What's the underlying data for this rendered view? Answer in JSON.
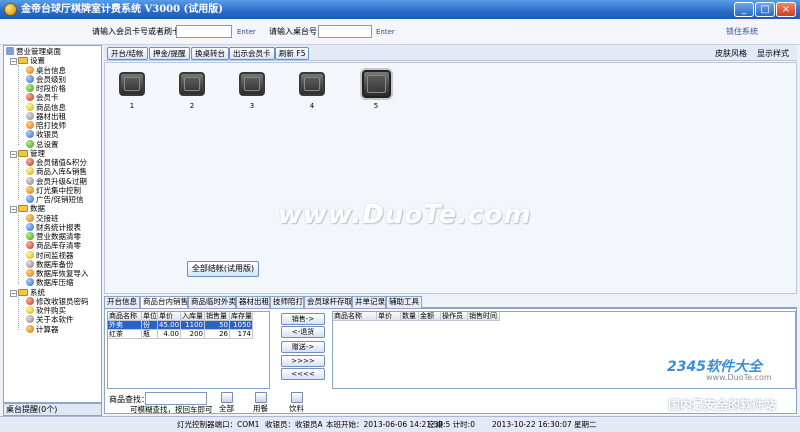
{
  "window": {
    "title": "金帝台球厅棋牌室计费系统 V3000 (试用版)",
    "minimize": "_",
    "maximize": "□",
    "close": "×"
  },
  "topbar": {
    "member_card_label": "请输入会员卡号或者刷卡：",
    "member_card_value": "",
    "enter1": "Enter",
    "table_no_label": "请输入桌台号：",
    "table_no_value": "",
    "enter2": "Enter",
    "lock_system": "锁住系统"
  },
  "tree": {
    "root": "营业管理桌面",
    "groups": [
      {
        "label": "设置",
        "items": [
          "桌台信息",
          "会员级别",
          "时段价格",
          "会员卡",
          "商品信息",
          "器材出租",
          "陪打技师",
          "收银员",
          "总设置"
        ]
      },
      {
        "label": "管理",
        "items": [
          "会员储值&积分",
          "商品入库&销售",
          "会员升级&过期",
          "灯光集中控制",
          "广告/促销短信"
        ]
      },
      {
        "label": "数据",
        "items": [
          "交接班",
          "财务统计报表",
          "营业数据清零",
          "商品库存清零",
          "时间监视器",
          "数据库备份",
          "数据库恢复导入",
          "数据库压缩"
        ]
      },
      {
        "label": "系统",
        "items": [
          "修改收银员密码",
          "软件购买",
          "关于本软件",
          "计算器"
        ]
      }
    ]
  },
  "reminder": "桌台提醒(0个)",
  "toolbar": {
    "buttons": [
      "开台/结帐",
      "押金/提醒",
      "换桌转台",
      "出示会员卡",
      "刷新 F5"
    ],
    "skin": "皮肤风格",
    "display_style": "显示样式"
  },
  "tables": [
    {
      "number": "1",
      "selected": false
    },
    {
      "number": "2",
      "selected": false
    },
    {
      "number": "3",
      "selected": false
    },
    {
      "number": "4",
      "selected": false
    },
    {
      "number": "5",
      "selected": true
    }
  ],
  "checkout_all": "全部结帐(试用版)",
  "watermark": "www.DuoTe.com",
  "tabs": [
    "开台信息",
    "商品台内销售",
    "商品临时外卖",
    "器材出租",
    "技师陪打",
    "会员球杆存取",
    "井单记录",
    "辅助工具"
  ],
  "active_tab": 1,
  "goods_table": {
    "headers": [
      "商品名称",
      "单位",
      "单价",
      "入库量",
      "销售量",
      "库存量"
    ],
    "rows": [
      [
        "外卖",
        "份",
        "45.00",
        "1100",
        "50",
        "1050"
      ],
      [
        "红茶",
        "瓶",
        "4.00",
        "200",
        "26",
        "174"
      ]
    ]
  },
  "action_buttons": [
    "销售->",
    "<-退货",
    "赠送->",
    ">>>>",
    "<<<<"
  ],
  "sold_table": {
    "headers": [
      "商品名称",
      "单价",
      "数量",
      "金额",
      "操作员",
      "销售时间"
    ]
  },
  "goods_search": {
    "label": "商品查找：",
    "value": "",
    "hint": "可模糊查找，按回车即可"
  },
  "categories": [
    "全部",
    "用餐",
    "饮料"
  ],
  "status": {
    "light": "灯光控制器端口：COM1",
    "cashier": "收银员：收银员A",
    "shift_start": "本班开始：2013-06-06 14:21:39",
    "empty": "空桌:5 计时:0",
    "now": "2013-10-22 16:30:07 星期二"
  },
  "wm": {
    "brand": "2345软件大全",
    "url": "www.DuoTe.com",
    "slogan": "国内最安全的软件站"
  }
}
